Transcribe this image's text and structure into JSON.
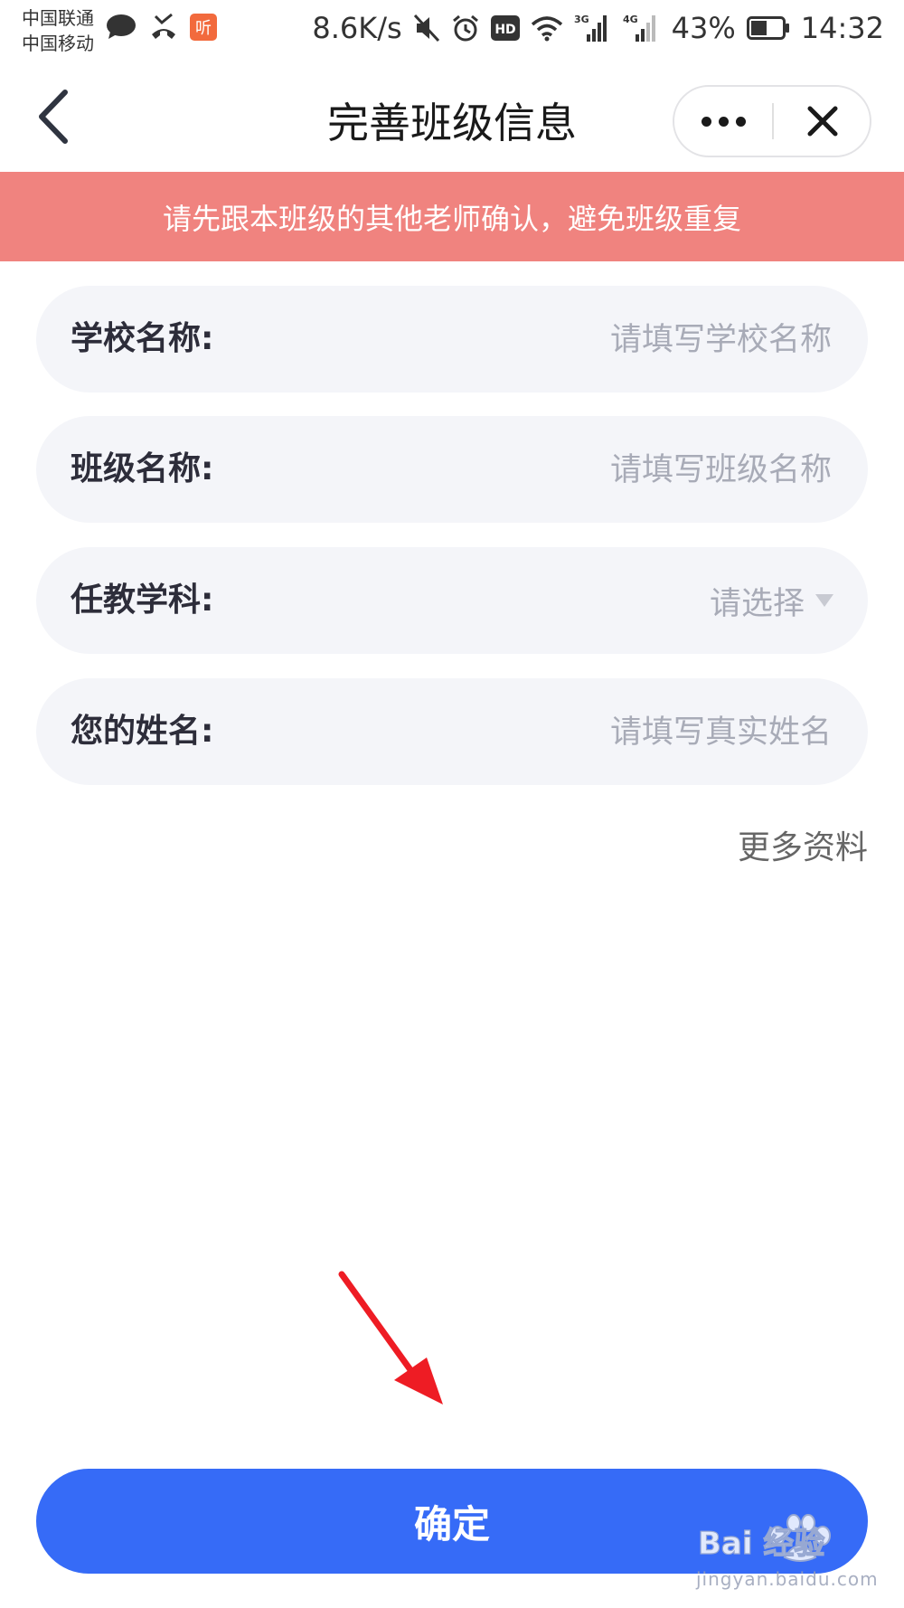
{
  "status_bar": {
    "carrier_1": "中国联通",
    "carrier_2": "中国移动",
    "app_badge": "听",
    "net_speed": "8.6K/s",
    "hd_badge": "HD",
    "sig1_label": "3G",
    "sig2_label": "4G",
    "battery": "43%",
    "time": "14:32"
  },
  "nav": {
    "title": "完善班级信息"
  },
  "notice": "请先跟本班级的其他老师确认，避免班级重复",
  "form": {
    "school": {
      "label": "学校名称:",
      "placeholder": "请填写学校名称",
      "value": ""
    },
    "class": {
      "label": "班级名称:",
      "placeholder": "请填写班级名称",
      "value": ""
    },
    "subject": {
      "label": "任教学科:",
      "selected": "请选择"
    },
    "name": {
      "label": "您的姓名:",
      "placeholder": "请填写真实姓名",
      "value": ""
    }
  },
  "more_link": "更多资料",
  "confirm_label": "确定",
  "watermark": {
    "brand": "Bai 经验",
    "url": "jingyan.baidu.com"
  },
  "colors": {
    "notice_bg": "#f0837f",
    "primary": "#366bf7",
    "field_bg": "#f4f5f9",
    "annotation": "#ee1c24"
  }
}
